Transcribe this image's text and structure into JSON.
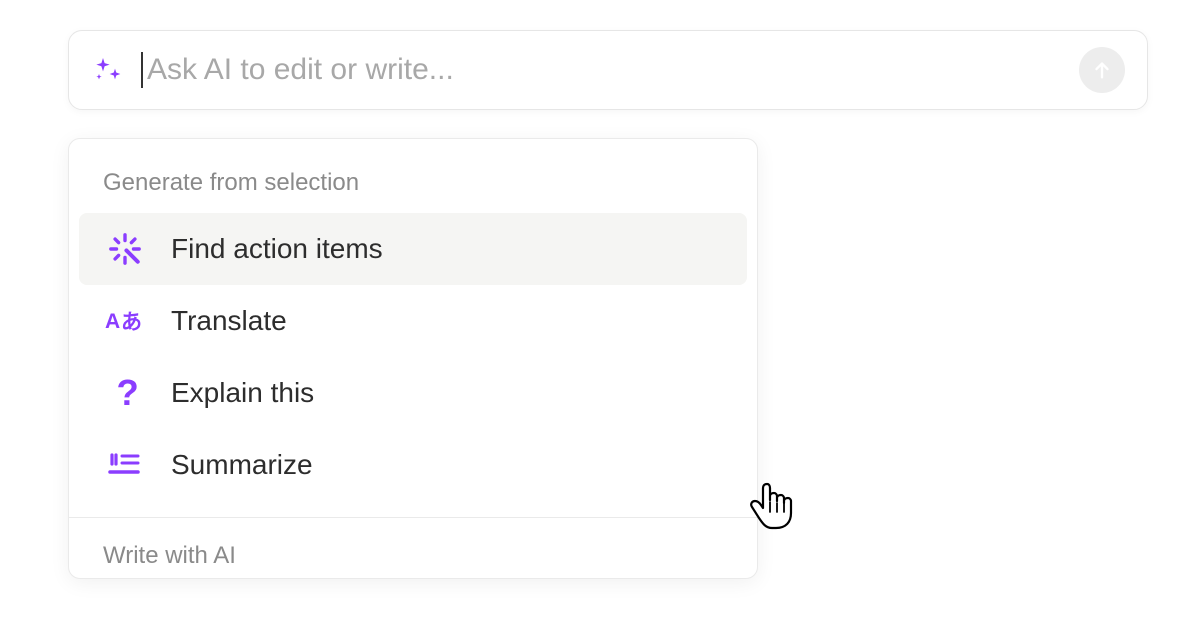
{
  "colors": {
    "accent": "#8b3dff",
    "placeholder": "#a8a8a8",
    "section_header": "#8a8a8a",
    "text": "#2d2d2d"
  },
  "input": {
    "placeholder": "Ask AI to edit or write...",
    "value": ""
  },
  "menu": {
    "section1_title": "Generate from selection",
    "items": [
      {
        "icon": "magic-wand-icon",
        "label": "Find action items",
        "highlighted": true
      },
      {
        "icon": "translate-icon",
        "label": "Translate",
        "highlighted": false
      },
      {
        "icon": "question-icon",
        "label": "Explain this",
        "highlighted": false
      },
      {
        "icon": "summarize-icon",
        "label": "Summarize",
        "highlighted": false
      }
    ],
    "section2_title": "Write with AI"
  }
}
